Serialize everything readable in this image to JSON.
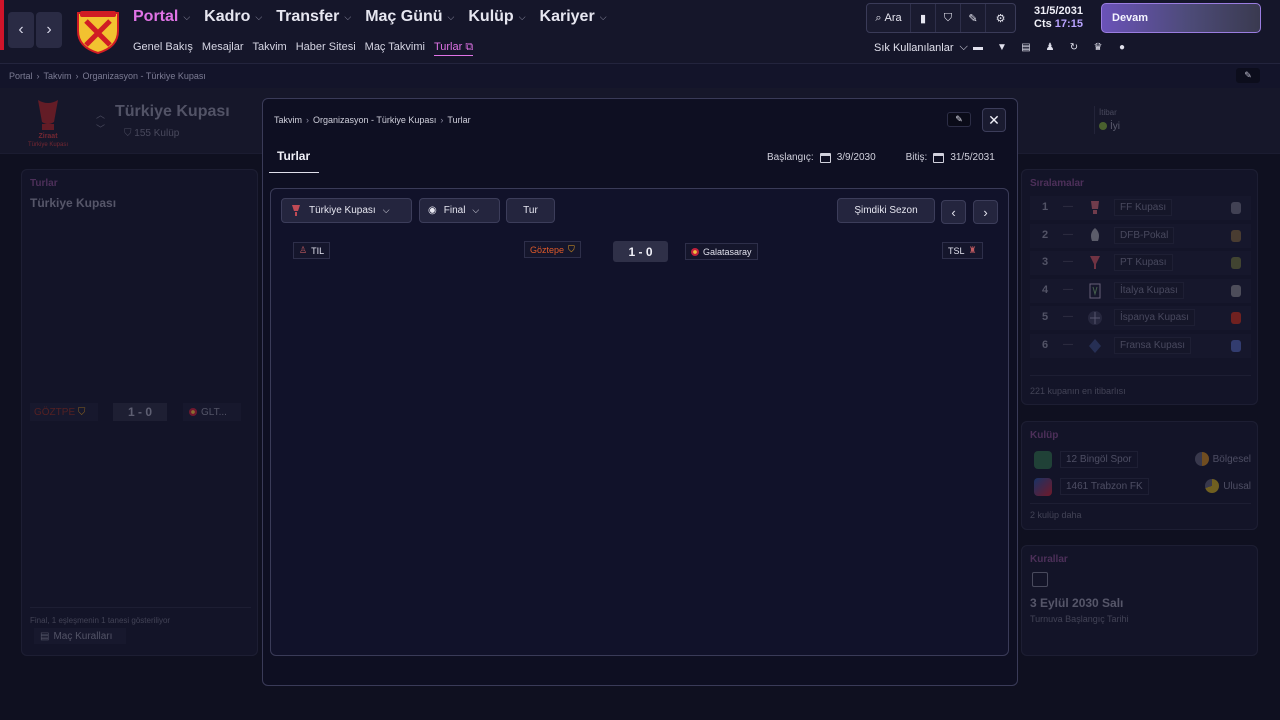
{
  "topbar": {
    "back": "‹",
    "forward": "›",
    "menu": [
      "Portal",
      "Kadro",
      "Transfer",
      "Maç Günü",
      "Kulüp",
      "Kariyer"
    ],
    "submenu": [
      "Genel Bakış",
      "Mesajlar",
      "Takvim",
      "Haber Sitesi",
      "Maç Takvimi",
      "Turlar"
    ],
    "search_label": "Ara",
    "date": "31/5/2031",
    "weekday": "Cts",
    "time": "17:15",
    "continue_label": "Devam",
    "shortcuts_label": "Sık Kullanılanlar"
  },
  "breadcrumb": [
    "Portal",
    "Takvim",
    "Organizasyon - Türkiye Kupası"
  ],
  "competition": {
    "name": "Türkiye Kupası",
    "clubs": "155 Kulüp",
    "logo_text": [
      "Ziraat",
      "Türkiye Kupası"
    ],
    "reputation_label": "İtibar",
    "reputation_value": "İyi"
  },
  "left_panel": {
    "title": "Turlar",
    "competition": "Türkiye Kupası",
    "home": "GÖZTPE",
    "score": "1 - 0",
    "away": "GLT...",
    "footer": "Final, 1 eşleşmenin 1 tanesi gösteriliyor",
    "rules_button": "Maç Kuralları"
  },
  "rankings": {
    "title": "Sıralamalar",
    "items": [
      {
        "rank": "1",
        "change": "—",
        "name": "FF Kupası"
      },
      {
        "rank": "2",
        "change": "—",
        "name": "DFB-Pokal"
      },
      {
        "rank": "3",
        "change": "—",
        "name": "PT Kupası"
      },
      {
        "rank": "4",
        "change": "—",
        "name": "İtalya Kupası"
      },
      {
        "rank": "5",
        "change": "—",
        "name": "İspanya Kupası"
      },
      {
        "rank": "6",
        "change": "—",
        "name": "Fransa Kupası"
      }
    ],
    "footer": "221 kupanın en itibarlısı"
  },
  "clubs": {
    "title": "Kulüp",
    "items": [
      {
        "name": "12 Bingöl Spor",
        "category": "Bölgesel"
      },
      {
        "name": "1461 Trabzon FK",
        "category": "Ulusal"
      }
    ],
    "more": "2 kulüp daha"
  },
  "rules": {
    "title": "Kurallar",
    "date": "3 Eylül 2030 Salı",
    "subtitle": "Turnuva Başlangıç Tarihi"
  },
  "modal": {
    "breadcrumb": [
      "Takvim",
      "Organizasyon - Türkiye Kupası",
      "Turlar"
    ],
    "tab": "Turlar",
    "start_label": "Başlangıç:",
    "start_date": "3/9/2030",
    "end_label": "Bitiş:",
    "end_date": "31/5/2031",
    "competition_select": "Türkiye Kupası",
    "stage_select": "Final",
    "round_button": "Tur",
    "season_button": "Şimdiki Sezon",
    "match": {
      "home_league": "TIL",
      "home": "Göztepe",
      "score": "1 - 0",
      "away": "Galatasaray",
      "away_league": "TSL"
    }
  }
}
